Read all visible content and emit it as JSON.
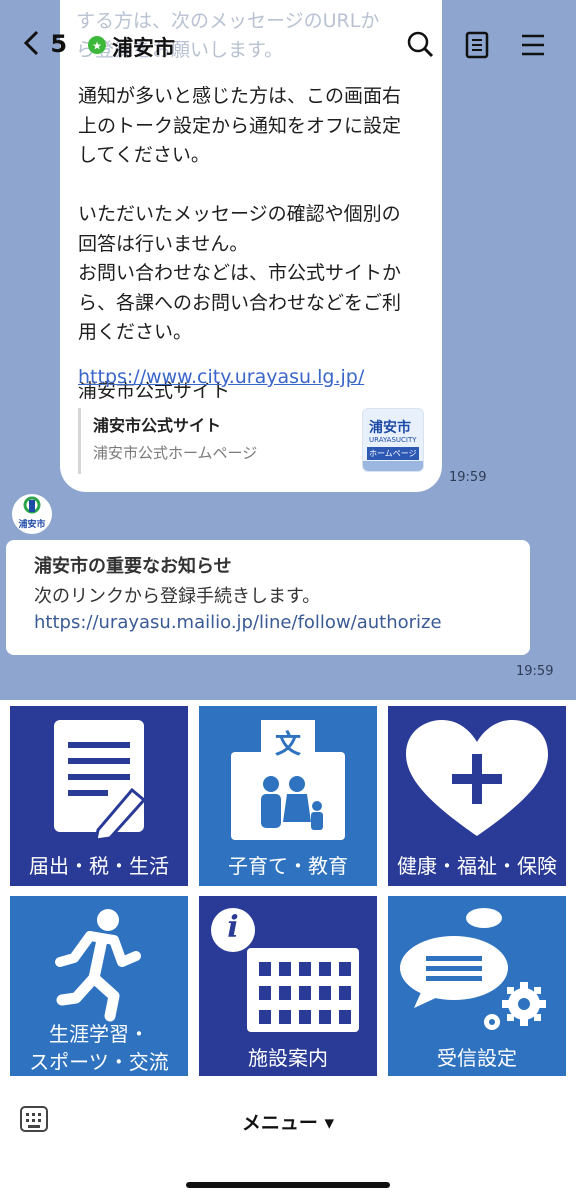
{
  "header": {
    "back_count": "5",
    "title": "浦安市"
  },
  "chat": {
    "ghost_text": "別な件の重要なお知らせの配信を希望\nする方は、次のメッセージのURLか\nら登録をお願いします。",
    "message_body": "通知が多いと感じた方は、この画面右\n上のトーク設定から通知をオフに設定\nしてください。\n\nいただいたメッセージの確認や個別の\n回答は行いません。\nお問い合わせなどは、市公式サイトか\nら、各課へのお問い合わせなどをご利\n用ください。\n\n浦安市公式サイト",
    "link": "https://www.city.urayasu.lg.jp/",
    "preview_title": "浦安市公式サイト",
    "preview_subtitle": "浦安市公式ホームページ",
    "thumb_title": "浦安市",
    "thumb_sub": "URAYASUCITY",
    "thumb_tag": "ホームページ",
    "time1": "19:59",
    "avatar_label": "浦安市",
    "notice_title": "浦安市の重要なお知らせ",
    "notice_line": "次のリンクから登録手続きします。",
    "notice_link": "https://urayasu.mailio.jp/line/follow/authorize",
    "time2": "19:59"
  },
  "rich_menu": {
    "tiles": [
      {
        "label": "届出・税・生活",
        "icon": "document-pen-icon"
      },
      {
        "label": "子育て・教育",
        "icon": "family-icon"
      },
      {
        "label": "健康・福祉・保険",
        "icon": "heart-plus-icon"
      },
      {
        "label": "生涯学習・\nスポーツ・交流",
        "icon": "runner-icon"
      },
      {
        "label": "施設案内",
        "icon": "building-info-icon"
      },
      {
        "label": "受信設定",
        "icon": "message-gear-icon"
      }
    ],
    "kanji_badge": "文",
    "info_glyph": "i"
  },
  "bottom_bar": {
    "menu_label": "メニュー ▾"
  },
  "colors": {
    "chat_bg": "#8ea6cf",
    "tile_dark": "#2a3a97",
    "tile_light": "#2f73c0",
    "link": "#3a66c9"
  }
}
